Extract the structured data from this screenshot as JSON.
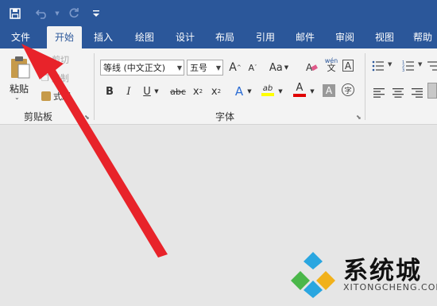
{
  "quick_access": {
    "save_icon": "save-icon",
    "undo_icon": "undo-icon",
    "redo_icon": "redo-icon",
    "customize_icon": "customize-icon"
  },
  "tabs": [
    "文件",
    "开始",
    "插入",
    "绘图",
    "设计",
    "布局",
    "引用",
    "邮件",
    "审阅",
    "视图",
    "帮助"
  ],
  "active_tab": "开始",
  "clipboard": {
    "paste_label": "粘贴",
    "cut_label": "剪切",
    "copy_label": "复制",
    "format_painter_label": "式刷",
    "group_label": "剪贴板"
  },
  "font": {
    "font_name": "等线 (中文正文)",
    "font_size": "五号",
    "group_label": "字体",
    "grow_label": "A",
    "shrink_label": "A",
    "case_label": "Aa",
    "phonetic_label": "wén",
    "border_char_label": "A",
    "bold_label": "B",
    "italic_label": "I",
    "underline_label": "U",
    "strike_label": "abc",
    "subscript_label": "x",
    "superscript_label": "x",
    "effects_label": "A",
    "highlight_label": "ab",
    "font_color_label": "A",
    "shading_label": "A",
    "enclose_label": "字"
  },
  "colors": {
    "title_bar": "#2b579a",
    "ribbon": "#f3f3f3",
    "arrow": "#e8232a",
    "highlight_yellow": "#ffff00",
    "font_red": "#e00000"
  },
  "watermark": {
    "text": "系统城",
    "sub": "XITONGCHENG.COM"
  }
}
